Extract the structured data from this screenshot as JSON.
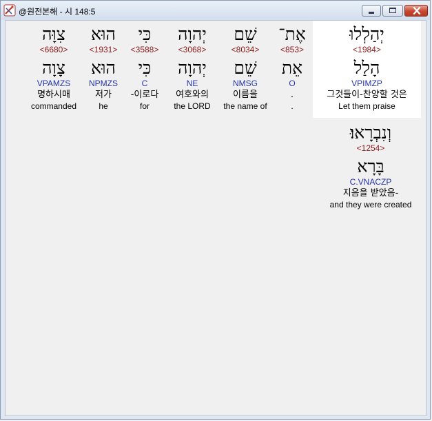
{
  "window": {
    "title": "@원전본해 - 시 148:5"
  },
  "words": [
    {
      "hebrew": "יְהַלְלוּ",
      "strong": "<1984>",
      "lemma": "הָלַל",
      "parse": "VPIMZP",
      "korean": "그것들이-찬양할 것은",
      "english": "Let them praise"
    },
    {
      "hebrew": "אֶת־",
      "strong": "<853>",
      "lemma": "אֵת",
      "parse": "O",
      "korean": ".",
      "english": "."
    },
    {
      "hebrew": "שֵׁם",
      "strong": "<8034>",
      "lemma": "שֵׁם",
      "parse": "NMSG",
      "korean": "이름을",
      "english": "the name of"
    },
    {
      "hebrew": "יְהוָה",
      "strong": "<3068>",
      "lemma": "יְהוָה",
      "parse": "NE",
      "korean": "여호와의",
      "english": "the LORD"
    },
    {
      "hebrew": "כִּי",
      "strong": "<3588>",
      "lemma": "כִּי",
      "parse": "C",
      "korean": "-이로다",
      "english": "for"
    },
    {
      "hebrew": "הוּא",
      "strong": "<1931>",
      "lemma": "הוּא",
      "parse": "NPMZS",
      "korean": "저가",
      "english": "he"
    },
    {
      "hebrew": "צִוָּה",
      "strong": "<6680>",
      "lemma": "צָוָה",
      "parse": "VPAMZS",
      "korean": "명하시매",
      "english": "commanded"
    },
    {
      "hebrew": "וְנִבְרָאוּ׃",
      "strong": "<1254>",
      "lemma": "בָּרָא",
      "parse": "C.VNACZP",
      "korean": "지음을 받았음-",
      "english": "and they were created"
    }
  ]
}
